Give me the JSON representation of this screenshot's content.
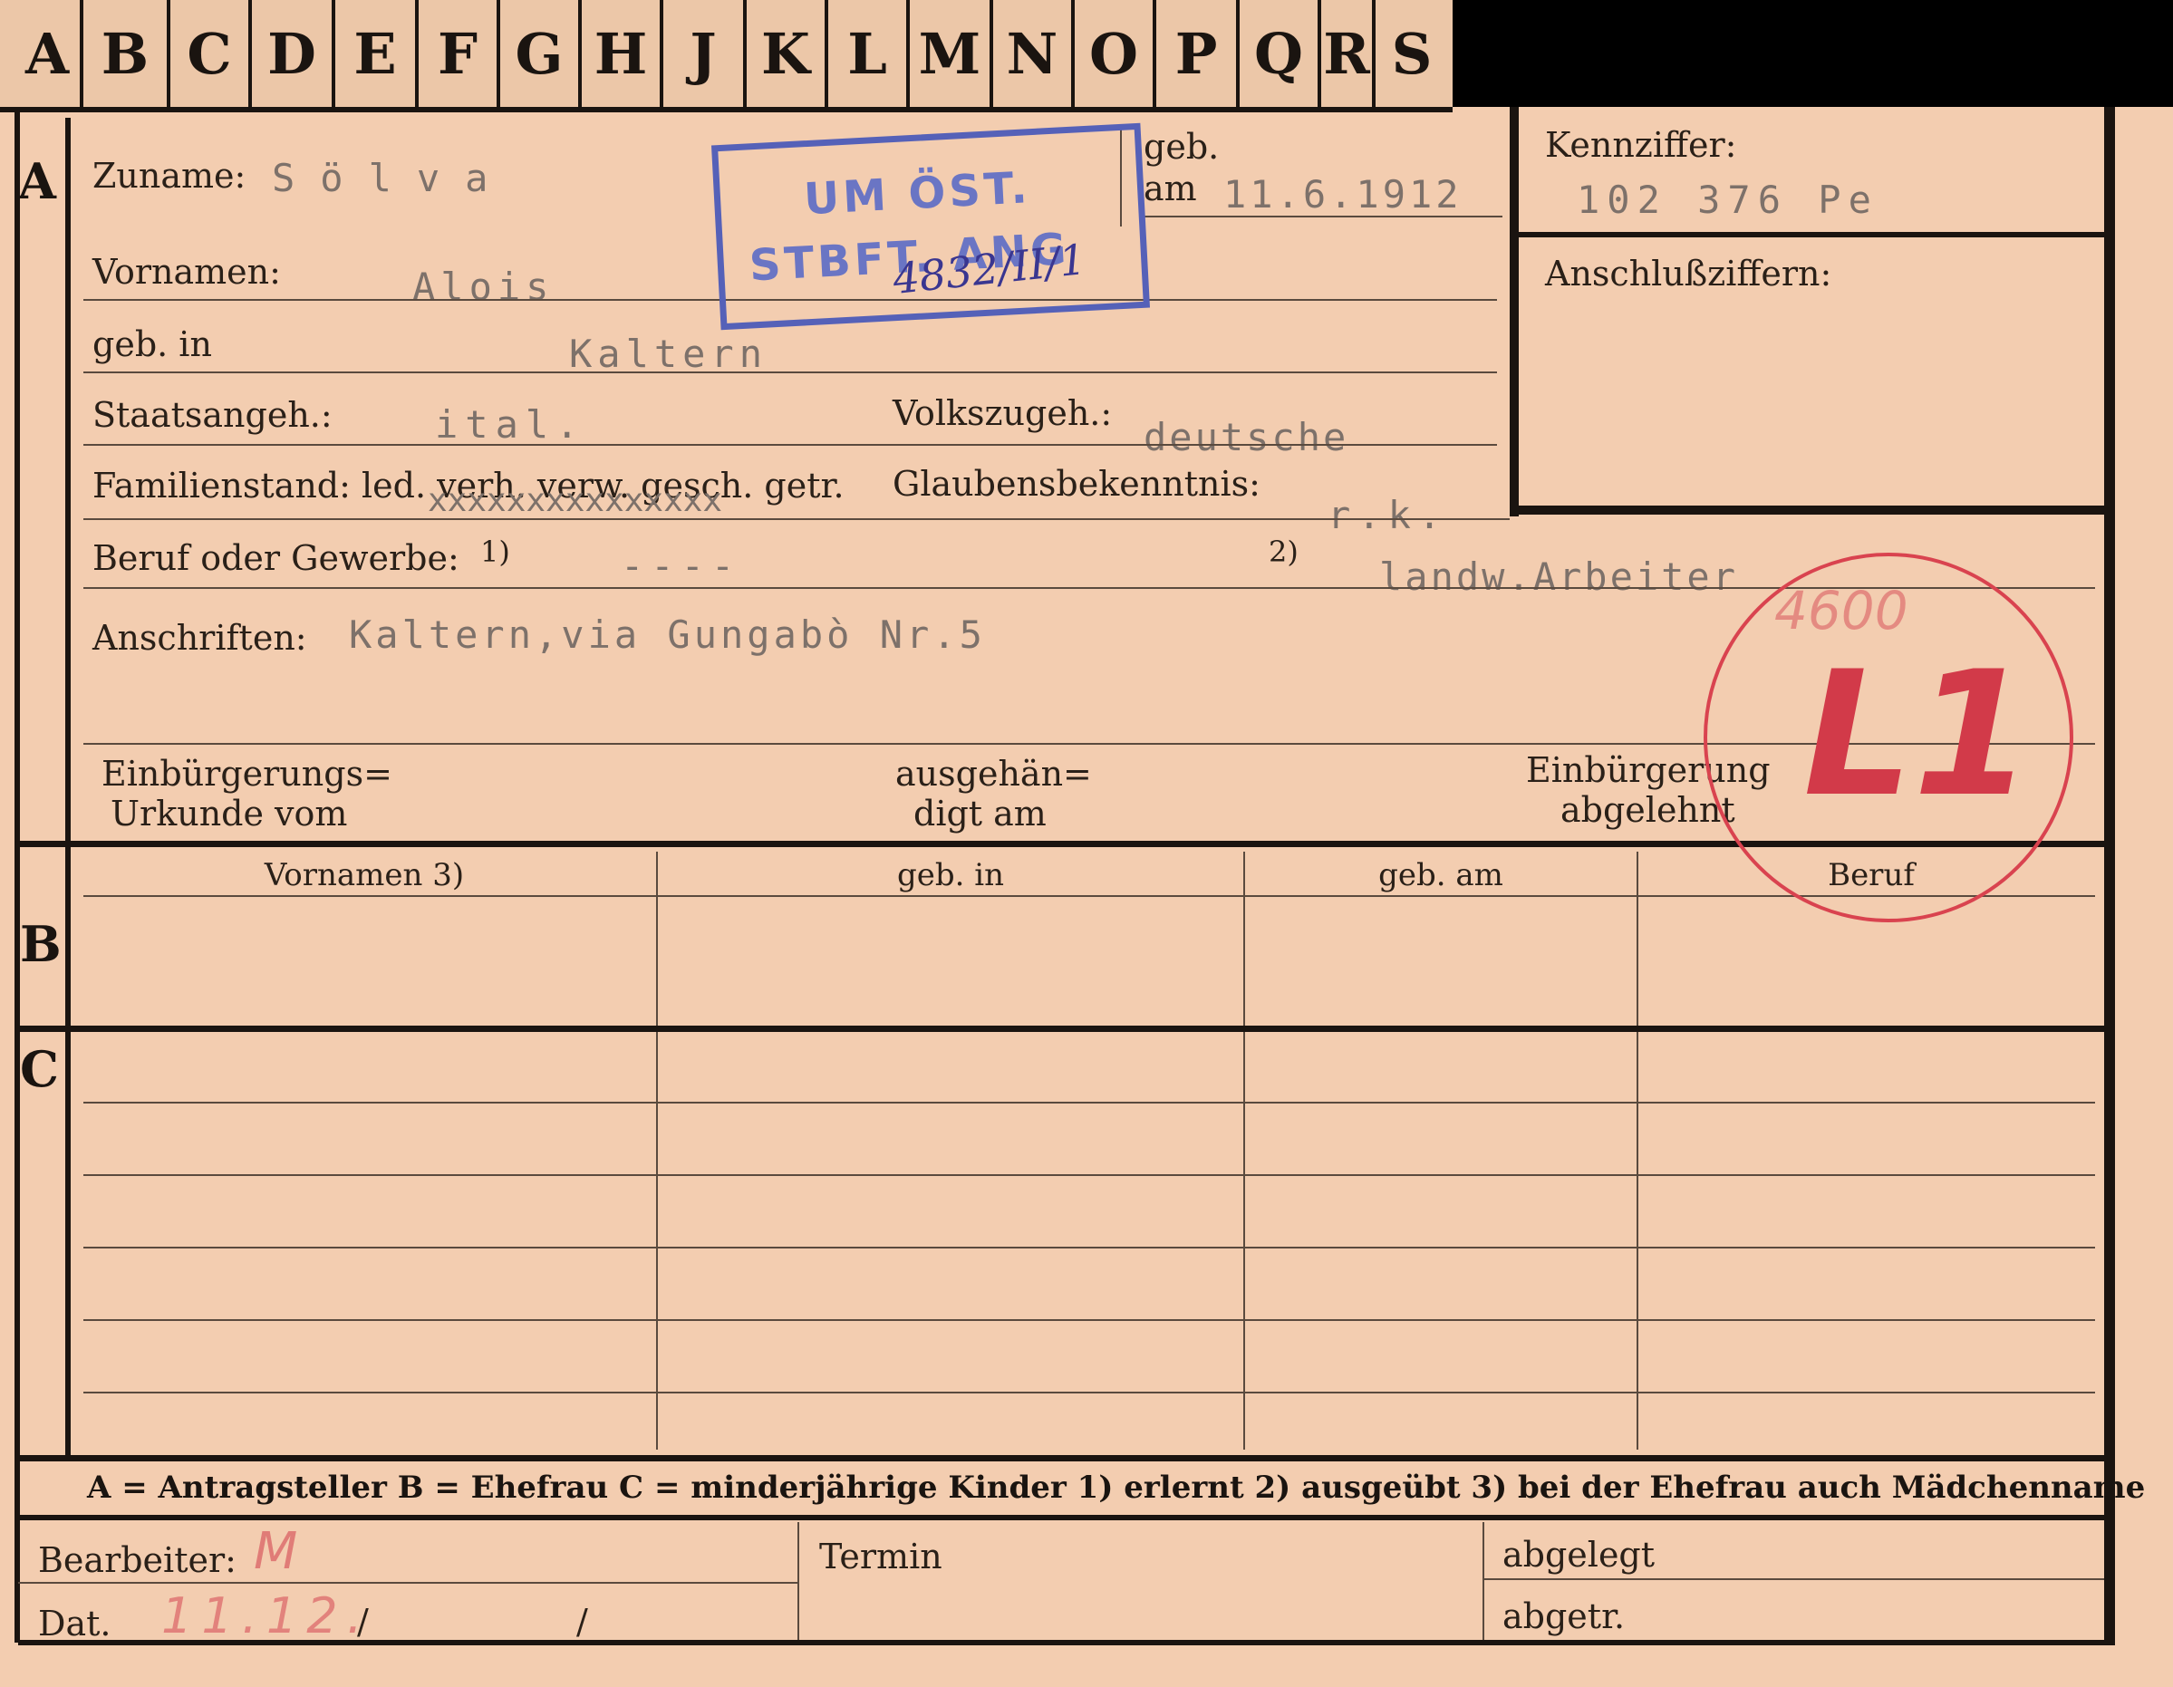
{
  "tabs": [
    "A",
    "B",
    "C",
    "D",
    "E",
    "F",
    "G",
    "H",
    "J",
    "K",
    "L",
    "M",
    "N",
    "O",
    "P",
    "Q",
    "R",
    "S"
  ],
  "section_a": {
    "marker": "A",
    "zuname_label": "Zuname:",
    "zuname_value": "Sölva",
    "geb_label": "geb.",
    "am_label": "am",
    "birth_date": "11.6.1912",
    "vornamen_label": "Vornamen:",
    "vornamen_value": "Alois",
    "geb_in_label": "geb. in",
    "geb_in_value": "Kaltern",
    "staatsangeh_label": "Staatsangeh.:",
    "staatsangeh_value": "ital.",
    "volkszugeh_label": "Volkszugeh.:",
    "volkszugeh_value": "deutsche",
    "familienstand_label": "Familienstand: led. verh. verw. gesch. getr.",
    "familienstand_strike": "xxxxxxxxxxxxxxx",
    "glaubens_label": "Glaubensbekenntnis:",
    "glaubens_value": "r.k.",
    "beruf_label": "Beruf oder Gewerbe:",
    "beruf_note1": "1)",
    "beruf_value1": "----",
    "beruf_note2": "2)",
    "beruf_value2": "landw.Arbeiter",
    "anschriften_label": "Anschriften:",
    "anschriften_value": "Kaltern,via Gungabò Nr.5",
    "einb_urkunde_label_1": "Einbürgerungs=",
    "einb_urkunde_label_2": "Urkunde vom",
    "ausgehaendigt_label_1": "ausgehän=",
    "ausgehaendigt_label_2": "digt am",
    "einb_abgelehnt_label_1": "Einbürgerung",
    "einb_abgelehnt_label_2": "abgelehnt"
  },
  "kennziffer": {
    "label": "Kennziffer:",
    "value": "102 376 Pe",
    "anschluss_label": "Anschlußziffern:"
  },
  "stamp": {
    "line1": "UM ÖST.",
    "line2": "STBFT. ANG",
    "handwritten": "4832/II/1"
  },
  "red_marks": {
    "number": "4600",
    "code": "L1"
  },
  "section_b": {
    "marker": "B",
    "columns": [
      "Vornamen 3)",
      "geb. in",
      "geb. am",
      "Beruf"
    ]
  },
  "section_c": {
    "marker": "C"
  },
  "legend": "A = Antragsteller   B = Ehefrau   C = minderjährige Kinder   1) erlernt   2) ausgeübt   3) bei der Ehefrau auch Mädchenname",
  "footer": {
    "bearbeiter_label": "Bearbeiter:",
    "bearbeiter_mark": "M",
    "dat_label": "Dat.",
    "dat_mark": "11.12.",
    "slash1": "/",
    "slash2": "/",
    "termin_label": "Termin",
    "abgelegt_label": "abgelegt",
    "abgetr_label": "abgetr."
  },
  "colors": {
    "card": "#f3cdb0",
    "ink": "#1a1410",
    "stamp_blue": "#5561b8",
    "stamp_red": "#d9434f"
  }
}
